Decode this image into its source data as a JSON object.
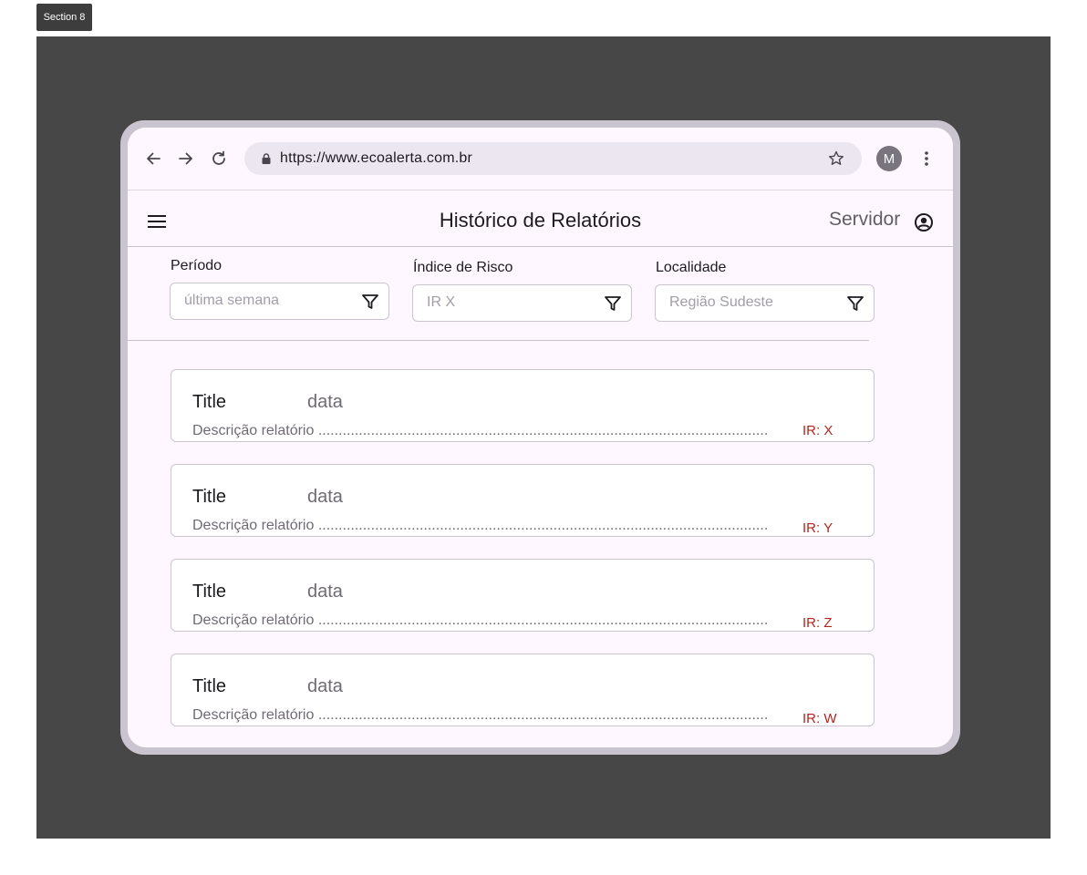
{
  "section": {
    "label": "Section 8"
  },
  "browser": {
    "url": "https://www.ecoalerta.com.br",
    "avatar_letter": "M"
  },
  "header": {
    "title": "Histórico de Relatórios",
    "user_label": "Servidor"
  },
  "filters": [
    {
      "label": "Período",
      "placeholder": "última semana"
    },
    {
      "label": "Índice de Risco",
      "placeholder": "IR X"
    },
    {
      "label": "Localidade",
      "placeholder": "Região Sudeste"
    }
  ],
  "reports": [
    {
      "title": "Title",
      "date": "data",
      "description": "Descrição relatório ...................................................................................................................",
      "risk": "IR: X"
    },
    {
      "title": "Title",
      "date": "data",
      "description": "Descrição relatório ...................................................................................................................",
      "risk": "IR: Y"
    },
    {
      "title": "Title",
      "date": "data",
      "description": "Descrição relatório ...................................................................................................................",
      "risk": "IR: Z"
    },
    {
      "title": "Title",
      "date": "data",
      "description": "Descrição relatório ...................................................................................................................",
      "risk": "IR: W"
    }
  ],
  "colors": {
    "canvas": "#474747",
    "frame": "#cac4d0",
    "surface": "#fef7ff",
    "risk_text": "#b3261e"
  }
}
